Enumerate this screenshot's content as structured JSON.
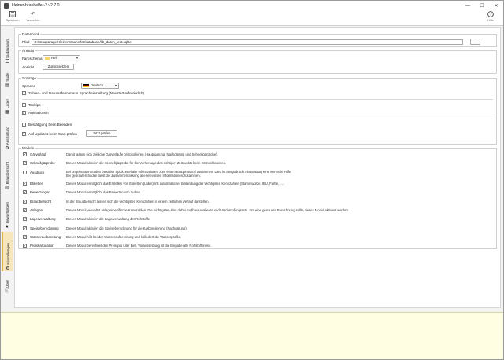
{
  "window": {
    "title": "kleiner-brauhelfer-2 v2.7.0",
    "controls": [
      "—",
      "☐",
      "✕"
    ]
  },
  "toolbar": {
    "save_label": "Speichern",
    "discard_label": "Verwerfen",
    "help_label": "Hilfe"
  },
  "sidebar": {
    "tabs": [
      {
        "label": "Sudauswahl",
        "icon": "list-icon"
      },
      {
        "label": "Sude",
        "icon": "book-icon"
      },
      {
        "label": "Lager",
        "icon": "storage-icon"
      },
      {
        "label": "Ausrüstung",
        "icon": "equipment-icon"
      },
      {
        "label": "Brauübersicht",
        "icon": "chart-icon"
      },
      {
        "label": "Bewertungen",
        "icon": "star-icon"
      },
      {
        "label": "Einstellungen",
        "icon": "settings-icon",
        "active": true
      },
      {
        "label": "Über",
        "icon": "info-icon"
      }
    ]
  },
  "datenbank": {
    "legend": "Datenbank",
    "pfad_label": "Pfad",
    "pfad_value": "D:/Brauparage/KleinerBrauhelfer/database/kb_daten_test.sqlite",
    "browse_label": "..."
  },
  "ansicht": {
    "legend": "Ansicht",
    "farbschema_label": "Farbschema",
    "farbschema_value": "Hell",
    "ansicht_label": "Ansicht",
    "reset_label": "Zurücksetzen"
  },
  "sonstige": {
    "legend": "Sonstige",
    "sprache_label": "Sprache",
    "sprache_value": "Deutsch",
    "zahlenformat_label": "Zahlen- und Datumsformat aus Spracheinstellung (Neustart erforderlich)",
    "zahlenformat_checked": false,
    "tooltips_label": "Tooltips",
    "tooltips_checked": false,
    "animationen_label": "Animationen",
    "animationen_checked": true,
    "bestaetigung_label": "Bestätigung beim Beenden",
    "bestaetigung_checked": false,
    "updates_label": "Auf Updates beim Start prüfen",
    "updates_checked": true,
    "jetzt_pruefen_label": "Jetzt prüfen"
  },
  "module": {
    "legend": "Module",
    "items": [
      {
        "name": "Gärverlauf",
        "checked": true,
        "desc": "Damit lassen sich zeitliche Gärverläufe protokollieren (Hauptgärung, Nachgärung und Schnellgärprobe)."
      },
      {
        "name": "Schnellgärprobe",
        "checked": true,
        "desc": "Dieses Modul aktiviert die Schnellgärprobe für die Vorhersage des richtigen Zeitpunkts beim Grünschlauchen."
      },
      {
        "name": "Ausdruck",
        "checked": false,
        "desc": "Bei ungebrauten Suden fasst der Spickzettel alle Informationen zum einem Brauprotokoll zusammen. Dies ist ausgedruckt ein Brautag eine wertvolle Hilfe.",
        "desc2": "Bei gebrauten Suden fasst die Zusammenfassung alle relevanten Informationen zusammen."
      },
      {
        "name": "Etiketten",
        "checked": true,
        "desc": "Dieses Modul ermöglicht das Erstellen von Etiketten (Label) mit automatischer Einbindung der wichtigsten Kennzahlen (Stammwürze, IBU, Farbe, ...)."
      },
      {
        "name": "Bewertungen",
        "checked": true,
        "desc": "Dieses Modul ermöglicht das Bewerten von Suden."
      },
      {
        "name": "Brauübersicht",
        "checked": true,
        "desc": "In der Brauübersicht lassen sich die wichtigsten Kennzahlen in einem zeitlichen Verlauf darstellen."
      },
      {
        "name": "Anlagen",
        "checked": true,
        "desc": "Dieses Modul verwaltet anlagespezifische Kennzahlen. Die wichtigsten sind dabei Sudhausausbeute und Verdampfungsrate. Für eine genauere Berechnung sollte dieses Modul aktiviert werden."
      },
      {
        "name": "Lagerverwaltung",
        "checked": true,
        "desc": "Dieses Modul aktiviert die Lagerverwaltung der Rohstoffe."
      },
      {
        "name": "Speiseberechnung",
        "checked": true,
        "desc": "Dieses Modul aktiviert die Speiseberechnung für die Karbonisierung (Nachgärung)."
      },
      {
        "name": "Wasseraufbereitung",
        "checked": true,
        "desc": "Dieses Modul hilft bei der Wasseraufbereitung und kalkuliert die Wasserprofile."
      },
      {
        "name": "Preiskalkulation",
        "checked": true,
        "desc": "Dieses Modul berechnet den Preis pro Liter Bier. Voraussetzung ist die Eingabe alle Rohstoffpreise."
      }
    ]
  },
  "colors": {
    "active_tab": "#f7e6bb",
    "footer_bg": "#fffee2"
  }
}
